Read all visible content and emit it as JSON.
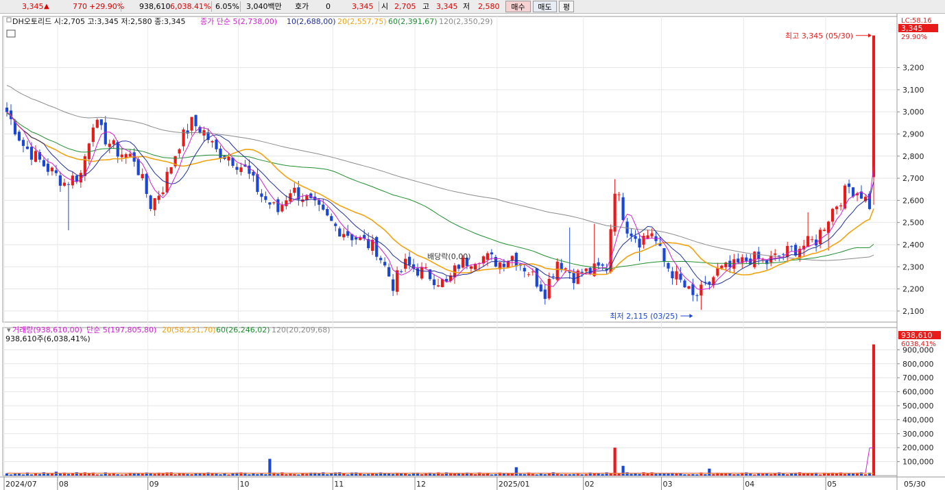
{
  "quote": {
    "price": "3,345",
    "change": "770",
    "change_pct": "+29.90%",
    "volume": "938,610",
    "volume_pct": "6,038.41%",
    "turnover": "6.05%",
    "amount": "3,040백만",
    "hoga_label": "호가",
    "hoga_value": "0",
    "hoga_price": "3,345",
    "open_label": "시",
    "open": "2,705",
    "high_label": "고",
    "high": "3,345",
    "low_label": "저",
    "low": "2,580",
    "buy_label": "매수",
    "sell_label": "매도",
    "avg_label": "평"
  },
  "colors": {
    "up": "#e81b1b",
    "down": "#1b47d8",
    "ma5": "#d21ed2",
    "ma10": "#1f2e9f",
    "ma20": "#f2a20e",
    "ma60": "#1e8f2e",
    "ma120": "#8a8a8a"
  },
  "chart_data": [
    {
      "type": "candlestick",
      "title": "DH오토리드 시:2,705 고:3,345 저:2,580 종:3,345",
      "legend": [
        "종가 단순 5(2,738,00)",
        "10(2,688,00)",
        "20(2,557,75)",
        "60(2,391,67)",
        "120(2,350,29)"
      ],
      "legend_prefix": "종가 단순",
      "ylim": [
        2050,
        3400
      ],
      "y_ticks": [
        "3,200",
        "3,100",
        "3,000",
        "2,900",
        "2,800",
        "2,700",
        "2,600",
        "2,500",
        "2,400",
        "2,300",
        "2,200",
        "2,100"
      ],
      "x_ticks": [
        "2024/07",
        "08",
        "09",
        "10",
        "11",
        "12",
        "2025/01",
        "02",
        "03",
        "04",
        "05"
      ],
      "right_labels": {
        "lc": "LC:58.16",
        "price": "3,345",
        "pct": "29.90%"
      },
      "annotations": {
        "high": "최고 3,345 (05/30)",
        "low": "최저 2,115 (03/25)",
        "event": "배당락(0,00)"
      },
      "anchors": [
        [
          0,
          3000
        ],
        [
          4,
          2850
        ],
        [
          9,
          2760
        ],
        [
          14,
          2680
        ],
        [
          18,
          2720
        ],
        [
          21,
          2960
        ],
        [
          24,
          2880
        ],
        [
          27,
          2820
        ],
        [
          31,
          2790
        ],
        [
          35,
          2580
        ],
        [
          38,
          2660
        ],
        [
          42,
          2860
        ],
        [
          45,
          2950
        ],
        [
          48,
          2910
        ],
        [
          51,
          2820
        ],
        [
          54,
          2800
        ],
        [
          58,
          2740
        ],
        [
          62,
          2620
        ],
        [
          66,
          2550
        ],
        [
          69,
          2650
        ],
        [
          72,
          2620
        ],
        [
          76,
          2550
        ],
        [
          80,
          2480
        ],
        [
          85,
          2430
        ],
        [
          90,
          2380
        ],
        [
          94,
          2220
        ],
        [
          97,
          2310
        ],
        [
          102,
          2270
        ],
        [
          107,
          2220
        ],
        [
          110,
          2310
        ],
        [
          115,
          2350
        ],
        [
          120,
          2320
        ],
        [
          123,
          2350
        ],
        [
          127,
          2280
        ],
        [
          131,
          2190
        ],
        [
          134,
          2330
        ],
        [
          138,
          2260
        ],
        [
          142,
          2280
        ],
        [
          146,
          2300
        ],
        [
          148,
          2660
        ],
        [
          151,
          2480
        ],
        [
          154,
          2420
        ],
        [
          157,
          2460
        ],
        [
          160,
          2320
        ],
        [
          164,
          2230
        ],
        [
          167,
          2160
        ],
        [
          170,
          2200
        ],
        [
          173,
          2280
        ],
        [
          177,
          2300
        ],
        [
          181,
          2340
        ],
        [
          185,
          2320
        ],
        [
          189,
          2360
        ],
        [
          193,
          2390
        ],
        [
          197,
          2420
        ],
        [
          201,
          2560
        ],
        [
          205,
          2660
        ],
        [
          208,
          2630
        ],
        [
          210,
          2580
        ],
        [
          211,
          2705
        ]
      ],
      "last_candle": {
        "open": 2705,
        "high": 3345,
        "low": 2580,
        "close": 3345
      }
    },
    {
      "type": "bar",
      "title": "거래량(938,610,00)",
      "legend": [
        "단순 5(197,805,80)",
        "20(58,231,70)",
        "60(26,246,02)",
        "120(20,209,68)"
      ],
      "sub_label": "938,610주(6,038,41%)",
      "ylim": [
        0,
        1000000
      ],
      "y_ticks": [
        "900,000",
        "800,000",
        "700,000",
        "600,000",
        "500,000",
        "400,000",
        "300,000",
        "200,000",
        "100,000"
      ],
      "right_labels": {
        "value": "938,610",
        "pct": "6038,41%"
      },
      "last_date": "05/30",
      "last_value": 938610,
      "spikes": [
        [
          12,
          28000
        ],
        [
          64,
          120000
        ],
        [
          124,
          60000
        ],
        [
          148,
          200000
        ],
        [
          150,
          70000
        ],
        [
          171,
          50000
        ]
      ],
      "base_volume": 16000
    }
  ]
}
